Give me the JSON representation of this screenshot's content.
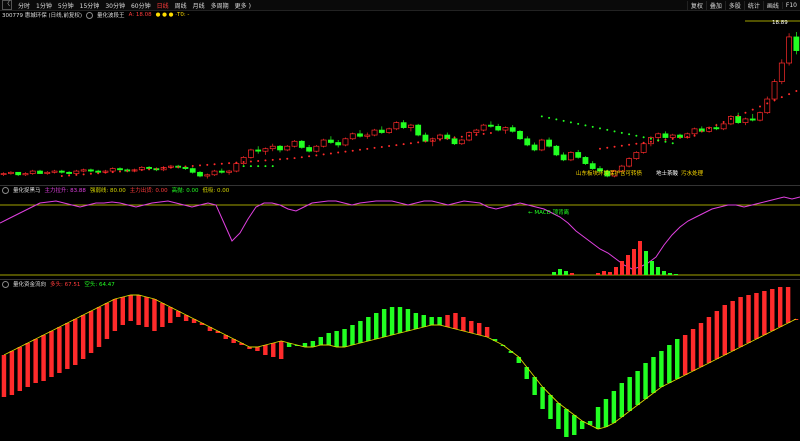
{
  "toolbar": {
    "back_label": "〈",
    "periods": [
      "分时",
      "1分钟",
      "5分钟",
      "15分钟",
      "30分钟",
      "60分钟",
      "日线",
      "周线",
      "月线",
      "多周期",
      "更多 )"
    ],
    "active_period": "日线",
    "right_items": [
      "复权",
      "叠加",
      "多股",
      "统计",
      "画线",
      "F10"
    ]
  },
  "main_panel": {
    "code": "300779 惠城环保 (日线,前复权)",
    "indicator_name": "量化波段王",
    "a_label": "A: 18.08",
    "markers": "● ● ● ·T0: -",
    "price_tag": "18.89",
    "annotation_news": "山东板块环境保护含可转债",
    "annotation_tags": "地士茶酸",
    "annotation_tags2": "污水处理"
  },
  "mid_panel": {
    "name": "量化捉黑马",
    "v1": "主力拉升: 83.88",
    "v2": "强弱线: 80.00",
    "v3": "主力出货: 0.00",
    "v4": "高抛: 0.00",
    "v5": "低吸: 0.00",
    "macd_label": "← MACD 顶背离"
  },
  "bottom_panel": {
    "name": "量化资金流向",
    "v1": "多头: 67.51",
    "v2": "空头: 64.47"
  },
  "colors": {
    "up": "#ff2b2b",
    "down": "#22ff22",
    "magenta": "#e040e0",
    "yellow": "#d8d800",
    "white": "#ffffff"
  },
  "chart_data": {
    "type": "candlestick",
    "candles": [
      [
        7.6,
        7.7,
        7.4,
        7.6
      ],
      [
        7.6,
        7.8,
        7.5,
        7.7
      ],
      [
        7.7,
        7.7,
        7.4,
        7.5
      ],
      [
        7.5,
        7.7,
        7.4,
        7.6
      ],
      [
        7.6,
        7.9,
        7.5,
        7.8
      ],
      [
        7.8,
        7.9,
        7.6,
        7.6
      ],
      [
        7.6,
        7.8,
        7.5,
        7.7
      ],
      [
        7.7,
        7.9,
        7.6,
        7.8
      ],
      [
        7.8,
        7.9,
        7.6,
        7.7
      ],
      [
        7.7,
        7.8,
        7.5,
        7.6
      ],
      [
        7.6,
        7.9,
        7.5,
        7.8
      ],
      [
        7.8,
        8.0,
        7.7,
        7.9
      ],
      [
        7.9,
        8.0,
        7.7,
        7.8
      ],
      [
        7.8,
        7.9,
        7.6,
        7.7
      ],
      [
        7.7,
        7.9,
        7.6,
        7.8
      ],
      [
        7.8,
        8.1,
        7.7,
        8.0
      ],
      [
        8.0,
        8.1,
        7.8,
        7.9
      ],
      [
        7.9,
        8.0,
        7.7,
        7.8
      ],
      [
        7.8,
        8.0,
        7.7,
        7.9
      ],
      [
        7.9,
        8.2,
        7.8,
        8.1
      ],
      [
        8.1,
        8.2,
        7.9,
        8.0
      ],
      [
        8.0,
        8.1,
        7.8,
        7.9
      ],
      [
        7.9,
        8.2,
        7.8,
        8.1
      ],
      [
        8.1,
        8.3,
        8.0,
        8.2
      ],
      [
        8.2,
        8.3,
        8.0,
        8.1
      ],
      [
        8.1,
        8.2,
        7.9,
        8.0
      ],
      [
        8.0,
        8.1,
        7.6,
        7.7
      ],
      [
        7.7,
        7.8,
        7.3,
        7.4
      ],
      [
        7.4,
        7.6,
        7.2,
        7.5
      ],
      [
        7.5,
        7.9,
        7.4,
        7.8
      ],
      [
        7.8,
        8.0,
        7.6,
        7.7
      ],
      [
        7.7,
        7.9,
        7.5,
        7.8
      ],
      [
        7.8,
        8.5,
        7.7,
        8.4
      ],
      [
        8.4,
        9.0,
        8.3,
        8.9
      ],
      [
        8.9,
        9.6,
        8.8,
        9.5
      ],
      [
        9.5,
        9.8,
        9.2,
        9.4
      ],
      [
        9.4,
        9.7,
        9.1,
        9.6
      ],
      [
        9.6,
        10.0,
        9.4,
        9.8
      ],
      [
        9.8,
        9.9,
        9.3,
        9.5
      ],
      [
        9.5,
        9.9,
        9.4,
        9.8
      ],
      [
        9.8,
        10.3,
        9.7,
        10.2
      ],
      [
        10.2,
        10.3,
        9.6,
        9.7
      ],
      [
        9.7,
        9.9,
        9.3,
        9.4
      ],
      [
        9.4,
        9.9,
        9.3,
        9.8
      ],
      [
        9.8,
        10.4,
        9.7,
        10.3
      ],
      [
        10.3,
        10.6,
        10.0,
        10.1
      ],
      [
        10.1,
        10.3,
        9.7,
        9.9
      ],
      [
        9.9,
        10.5,
        9.8,
        10.4
      ],
      [
        10.4,
        10.9,
        10.3,
        10.8
      ],
      [
        10.8,
        11.1,
        10.5,
        10.6
      ],
      [
        10.6,
        10.9,
        10.4,
        10.7
      ],
      [
        10.7,
        11.2,
        10.6,
        11.1
      ],
      [
        11.1,
        11.4,
        10.8,
        10.9
      ],
      [
        10.9,
        11.3,
        10.8,
        11.2
      ],
      [
        11.2,
        11.8,
        11.1,
        11.7
      ],
      [
        11.7,
        11.9,
        11.2,
        11.3
      ],
      [
        11.3,
        11.6,
        11.0,
        11.5
      ],
      [
        11.5,
        11.6,
        10.6,
        10.7
      ],
      [
        10.7,
        10.9,
        10.1,
        10.2
      ],
      [
        10.2,
        10.5,
        9.8,
        10.4
      ],
      [
        10.4,
        10.8,
        10.2,
        10.7
      ],
      [
        10.7,
        10.9,
        10.3,
        10.4
      ],
      [
        10.4,
        10.6,
        9.9,
        10.0
      ],
      [
        10.0,
        10.4,
        9.9,
        10.3
      ],
      [
        10.3,
        11.0,
        10.2,
        10.9
      ],
      [
        10.9,
        11.2,
        10.7,
        11.1
      ],
      [
        11.1,
        11.6,
        11.0,
        11.5
      ],
      [
        11.5,
        11.8,
        11.3,
        11.4
      ],
      [
        11.4,
        11.6,
        11.0,
        11.1
      ],
      [
        11.1,
        11.4,
        10.8,
        11.3
      ],
      [
        11.3,
        11.5,
        10.9,
        11.0
      ],
      [
        11.0,
        11.1,
        10.3,
        10.4
      ],
      [
        10.4,
        10.6,
        9.8,
        9.9
      ],
      [
        9.9,
        10.1,
        9.4,
        9.5
      ],
      [
        9.5,
        10.4,
        9.4,
        10.3
      ],
      [
        10.3,
        10.5,
        9.7,
        9.8
      ],
      [
        9.8,
        9.9,
        9.0,
        9.1
      ],
      [
        9.1,
        9.3,
        8.6,
        8.7
      ],
      [
        8.7,
        9.4,
        8.6,
        9.3
      ],
      [
        9.3,
        9.5,
        8.8,
        8.9
      ],
      [
        8.9,
        9.0,
        8.3,
        8.4
      ],
      [
        8.4,
        8.6,
        7.9,
        8.0
      ],
      [
        8.0,
        8.2,
        7.7,
        7.8
      ],
      [
        7.8,
        7.9,
        7.3,
        7.4
      ],
      [
        7.4,
        7.9,
        7.3,
        7.8
      ],
      [
        7.8,
        8.3,
        7.7,
        8.2
      ],
      [
        8.2,
        8.9,
        8.1,
        8.8
      ],
      [
        8.8,
        9.4,
        8.7,
        9.3
      ],
      [
        9.3,
        10.1,
        9.2,
        10.0
      ],
      [
        10.0,
        10.6,
        9.8,
        10.5
      ],
      [
        10.5,
        10.9,
        10.3,
        10.8
      ],
      [
        10.8,
        11.0,
        10.4,
        10.5
      ],
      [
        10.5,
        10.8,
        10.3,
        10.7
      ],
      [
        10.7,
        10.8,
        10.4,
        10.5
      ],
      [
        10.5,
        10.9,
        10.4,
        10.8
      ],
      [
        10.8,
        11.3,
        10.7,
        11.2
      ],
      [
        11.2,
        11.4,
        10.9,
        11.0
      ],
      [
        11.0,
        11.4,
        10.9,
        11.3
      ],
      [
        11.3,
        11.6,
        11.1,
        11.2
      ],
      [
        11.2,
        11.7,
        11.1,
        11.6
      ],
      [
        11.6,
        12.3,
        11.5,
        12.2
      ],
      [
        12.2,
        12.5,
        11.6,
        11.7
      ],
      [
        11.7,
        12.1,
        11.5,
        12.0
      ],
      [
        12.0,
        12.4,
        11.8,
        11.9
      ],
      [
        11.9,
        12.6,
        11.8,
        12.5
      ],
      [
        12.5,
        13.8,
        12.4,
        13.6
      ],
      [
        13.6,
        15.2,
        13.4,
        15.0
      ],
      [
        15.0,
        16.8,
        14.8,
        16.5
      ],
      [
        16.5,
        18.9,
        16.3,
        18.6
      ],
      [
        18.6,
        19.0,
        17.2,
        17.5
      ]
    ]
  }
}
